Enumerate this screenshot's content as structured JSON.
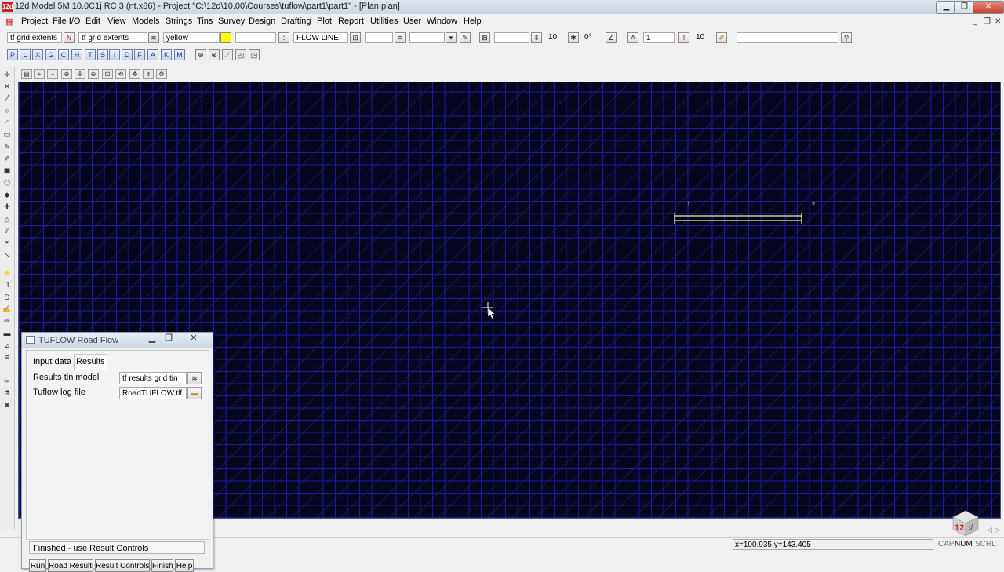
{
  "titlebar": {
    "app_icon_text": "12d",
    "title": "12d Model 5M 10.0C1j RC 3 (nt.x86) - Project \"C:\\12d\\10.00\\Courses\\tuflow\\part1\\part1\" - [Plan plan]",
    "minimize": "▁",
    "maximize": "❐",
    "close": "✕"
  },
  "menu": {
    "items": [
      "Project",
      "File I/O",
      "Edit",
      "View",
      "Models",
      "Strings",
      "Tins",
      "Survey",
      "Design",
      "Drafting",
      "Plot",
      "Report",
      "Utilities",
      "User",
      "Window",
      "Help"
    ],
    "mdi_minimize": "_",
    "mdi_restore": "❐",
    "mdi_close": "✕"
  },
  "toolbar": {
    "model_field": "tf grid extents",
    "model_button": "N",
    "model_field2": "tf grid extents",
    "colour_name": "yellow",
    "colour_swatch": "#ffff00",
    "style_field": "FLOW LINE",
    "num1": "10",
    "angle": "0°",
    "num2": "1",
    "text_btn": "T",
    "num3": "10"
  },
  "letter_buttons": [
    "P",
    "L",
    "X",
    "G",
    "C",
    "H",
    "T",
    "S",
    "I",
    "D",
    "F",
    "A",
    "K",
    "M"
  ],
  "canvas": {
    "label_start": "1",
    "label_end": "2",
    "line_color": "#f2f2a0"
  },
  "dialog": {
    "title": "TUFLOW Road Flow",
    "tabs": [
      "Input data",
      "Results"
    ],
    "results_tin_label": "Results tin model",
    "results_tin_value": "tf results grid tin",
    "log_label": "Tuflow log file",
    "log_value": "RoadTUFLOW.tlf",
    "status": "Finished - use Result Controls",
    "buttons": [
      "Run",
      "Road Results",
      "Result Controls",
      "Finish",
      "Help"
    ]
  },
  "statusbar": {
    "coords": "x=100.935 y=143.405",
    "cap": "CAP",
    "num": "NUM",
    "scrl": "SCRL"
  },
  "colors": {
    "canvas_background": "#05051d",
    "grid": "#1c1c9c"
  }
}
